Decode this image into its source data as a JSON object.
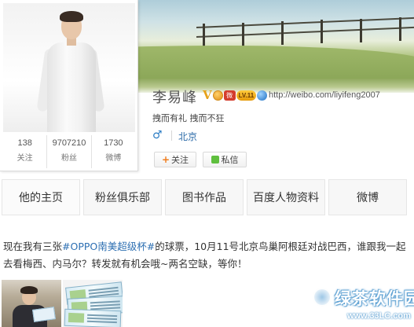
{
  "profile": {
    "name": "李易峰",
    "url": "http://weibo.com/liyifeng2007",
    "bio": "拽而有礼 拽而不狂",
    "gender_symbol": "♂",
    "location": "北京",
    "badges": {
      "verified": "V",
      "red_label": "微",
      "pill_label": "LV.11"
    },
    "stats": [
      {
        "value": "138",
        "label": "关注"
      },
      {
        "value": "9707210",
        "label": "粉丝"
      },
      {
        "value": "1730",
        "label": "微博"
      }
    ]
  },
  "actions": {
    "follow_plus": "+",
    "follow_label": "关注",
    "message_label": "私信"
  },
  "nav": {
    "tabs": [
      {
        "label": "他的主页"
      },
      {
        "label": "粉丝俱乐部"
      },
      {
        "label": "图书作品"
      },
      {
        "label": "百度人物资料"
      },
      {
        "label": "微博"
      }
    ]
  },
  "post": {
    "text_before": "现在我有三张",
    "hashtag": "#OPPO南美超级杯#",
    "text_after": "的球票，10月11号北京鸟巢阿根廷对战巴西，谁跟我一起去看梅西、内马尔？转发就有机会哦~两名空缺，等你！"
  },
  "watermark": {
    "title": "绿茶软件园",
    "url": "www.33LC.com"
  },
  "colors": {
    "link": "#2d6fb2",
    "badge_gold": "#e6a21a",
    "message_green": "#5fbf3e",
    "follow_orange": "#f07b1b"
  },
  "icons": [
    "verified-v-icon",
    "medal-icon",
    "weibo-red-icon",
    "level-pill-icon",
    "globe-icon",
    "male-gender-icon",
    "plus-icon",
    "message-icon",
    "watermark-logo-icon"
  ]
}
